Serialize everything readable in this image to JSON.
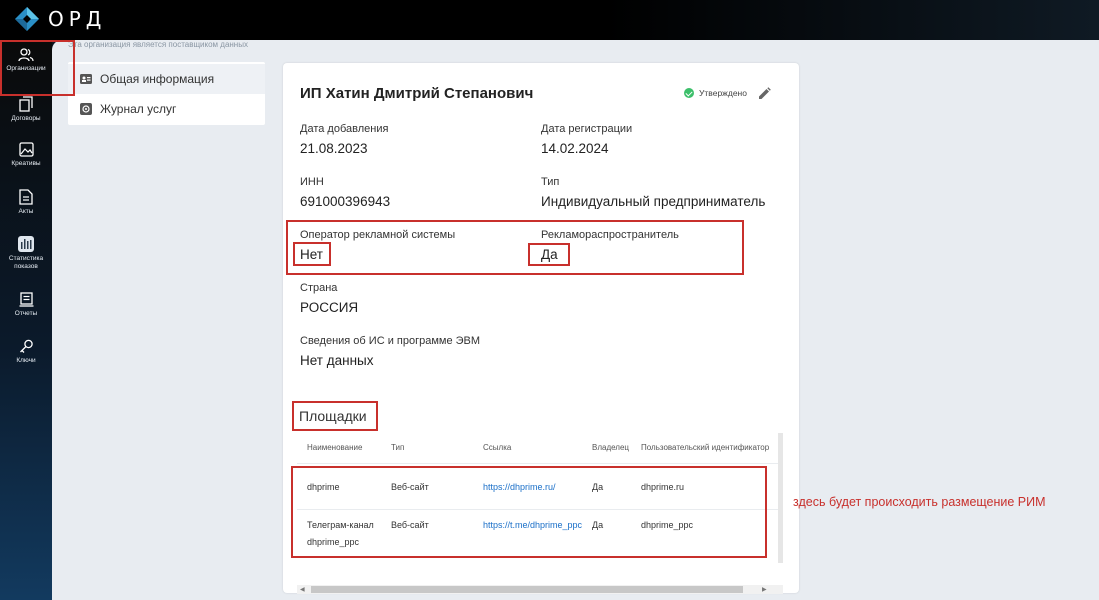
{
  "app": {
    "logo_text": "ОРД"
  },
  "sidebar": {
    "items": [
      {
        "label": "Организации",
        "icon": "users-icon"
      },
      {
        "label": "Договоры",
        "icon": "documents-icon"
      },
      {
        "label": "Креативы",
        "icon": "image-icon"
      },
      {
        "label": "Акты",
        "icon": "file-icon"
      },
      {
        "label": "Статистика показов",
        "icon": "stats-icon"
      },
      {
        "label": "Отчеты",
        "icon": "report-icon"
      },
      {
        "label": "Ключи",
        "icon": "key-icon"
      }
    ]
  },
  "notice": "Эта организация является поставщиком данных",
  "menu": {
    "items": [
      {
        "label": "Общая информация",
        "icon": "info-icon"
      },
      {
        "label": "Журнал услуг",
        "icon": "gear-icon"
      }
    ]
  },
  "org": {
    "title": "ИП Хатин Дмитрий Степанович",
    "status": "Утверждено",
    "fields": {
      "added_label": "Дата добавления",
      "added_value": "21.08.2023",
      "reg_label": "Дата регистрации",
      "reg_value": "14.02.2024",
      "inn_label": "ИНН",
      "inn_value": "691000396943",
      "type_label": "Тип",
      "type_value": "Индивидуальный предприниматель",
      "operator_label": "Оператор рекламной системы",
      "operator_value": "Нет",
      "distributor_label": "Рекламораспространитель",
      "distributor_value": "Да",
      "country_label": "Страна",
      "country_value": "РОССИЯ",
      "is_label": "Сведения об ИС и программе ЭВМ",
      "is_value": "Нет данных"
    }
  },
  "platforms": {
    "title": "Площадки",
    "columns": [
      "Наименование",
      "Тип",
      "Ссылка",
      "Владелец",
      "Пользовательский идентификатор"
    ],
    "rows": [
      {
        "name": "dhprime",
        "type": "Веб-сайт",
        "link": "https://dhprime.ru/",
        "owner": "Да",
        "user_id": "dhprime.ru"
      },
      {
        "name": "Телеграм-канал dhprime_ppc",
        "type": "Веб-сайт",
        "link": "https://t.me/dhprime_ppc",
        "owner": "Да",
        "user_id": "dhprime_ppc"
      }
    ]
  },
  "annotation": "здесь будет происходить размещение РИМ",
  "colors": {
    "highlight": "#c8302c",
    "link": "#1a6fc8",
    "status_ok": "#3cbf6a"
  }
}
